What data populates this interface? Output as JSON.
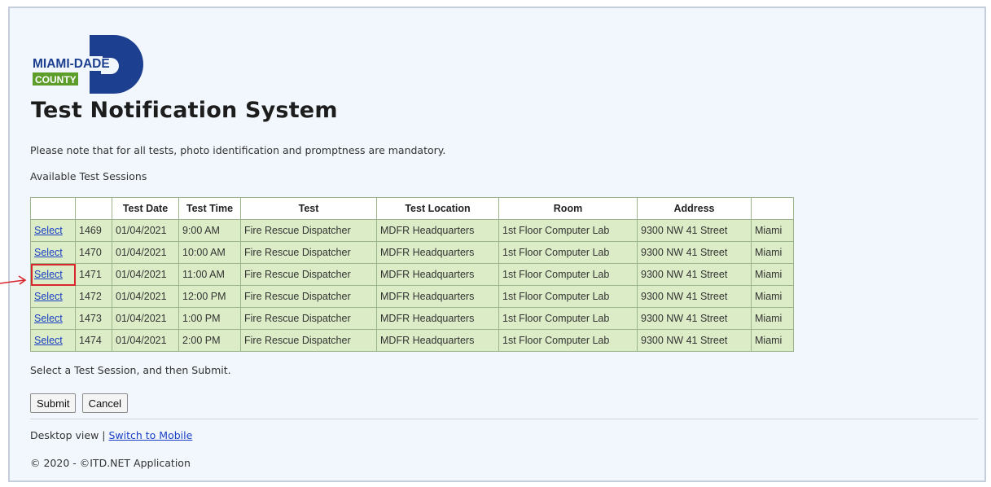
{
  "logo": {
    "top_text": "MIAMI-DADE",
    "bottom_text": "COUNTY",
    "colors": {
      "navy": "#1d3f8f",
      "green": "#5d9e2a"
    }
  },
  "page": {
    "title": "Test Notification System",
    "note": "Please note that for all tests, photo identification and promptness are mandatory.",
    "available_label": "Available Test Sessions",
    "hint": "Select a Test Session, and then Submit."
  },
  "table": {
    "headers": [
      "",
      "",
      "Test Date",
      "Test Time",
      "Test",
      "Test Location",
      "Room",
      "Address",
      ""
    ],
    "rows": [
      {
        "select": "Select",
        "id": "1469",
        "date": "01/04/2021",
        "time": "9:00 AM",
        "test": "Fire Rescue Dispatcher",
        "location": "MDFR Headquarters",
        "room": "1st Floor Computer Lab",
        "address": "9300 NW 41 Street",
        "city": "Miami"
      },
      {
        "select": "Select",
        "id": "1470",
        "date": "01/04/2021",
        "time": "10:00 AM",
        "test": "Fire Rescue Dispatcher",
        "location": "MDFR Headquarters",
        "room": "1st Floor Computer Lab",
        "address": "9300 NW 41 Street",
        "city": "Miami"
      },
      {
        "select": "Select",
        "id": "1471",
        "date": "01/04/2021",
        "time": "11:00 AM",
        "test": "Fire Rescue Dispatcher",
        "location": "MDFR Headquarters",
        "room": "1st Floor Computer Lab",
        "address": "9300 NW 41 Street",
        "city": "Miami"
      },
      {
        "select": "Select",
        "id": "1472",
        "date": "01/04/2021",
        "time": "12:00 PM",
        "test": "Fire Rescue Dispatcher",
        "location": "MDFR Headquarters",
        "room": "1st Floor Computer Lab",
        "address": "9300 NW 41 Street",
        "city": "Miami"
      },
      {
        "select": "Select",
        "id": "1473",
        "date": "01/04/2021",
        "time": "1:00 PM",
        "test": "Fire Rescue Dispatcher",
        "location": "MDFR Headquarters",
        "room": "1st Floor Computer Lab",
        "address": "9300 NW 41 Street",
        "city": "Miami"
      },
      {
        "select": "Select",
        "id": "1474",
        "date": "01/04/2021",
        "time": "2:00 PM",
        "test": "Fire Rescue Dispatcher",
        "location": "MDFR Headquarters",
        "room": "1st Floor Computer Lab",
        "address": "9300 NW 41 Street",
        "city": "Miami"
      }
    ],
    "highlighted_row_id": "1471"
  },
  "buttons": {
    "submit": "Submit",
    "cancel": "Cancel"
  },
  "footer": {
    "view_label": "Desktop view |",
    "switch_link": "Switch to Mobile",
    "copyright": "© 2020 - ©ITD.NET Application"
  },
  "annotation": {
    "icon": "arrow-right-icon",
    "color": "#d9262c"
  }
}
